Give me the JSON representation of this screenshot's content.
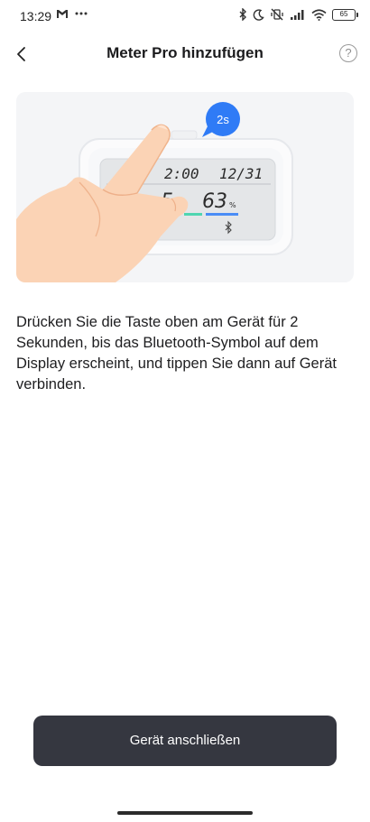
{
  "status_bar": {
    "time": "13:29",
    "battery": "65",
    "icons": [
      "gmail-icon",
      "more-icon",
      "bluetooth-icon",
      "moon-icon",
      "vibrate-off-icon",
      "signal-icon",
      "wifi-icon",
      "battery-icon"
    ]
  },
  "header": {
    "title": "Meter Pro hinzufügen",
    "help_symbol": "?"
  },
  "illustration": {
    "badge": "2s",
    "display_time": "2:00",
    "display_date": "12/31",
    "display_humidity": "63",
    "display_humidity_unit": "%",
    "display_temp_partial": "5"
  },
  "instruction": "Drücken Sie die Taste oben am Gerät für 2 Sekunden, bis das Bluetooth-Symbol auf dem Display erscheint, und tippen Sie dann auf Gerät verbinden.",
  "connect_button": "Gerät anschließen",
  "colors": {
    "button_bg": "#353740",
    "badge_blue": "#2f7bf6",
    "illustration_bg": "#f4f5f7"
  }
}
